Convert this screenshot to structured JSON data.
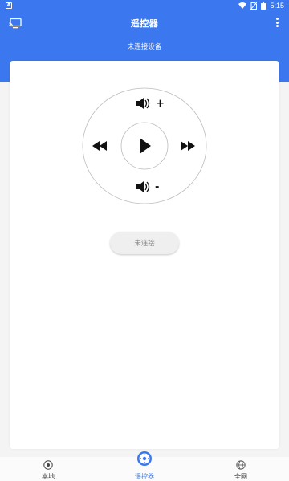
{
  "status_bar": {
    "notification_icon": "A",
    "time": "5:15",
    "icons": [
      "wifi-icon",
      "no-sim-icon",
      "battery-icon"
    ]
  },
  "app_bar": {
    "title": "遥控器",
    "subtitle": "未连接设备"
  },
  "remote": {
    "volume_up_label": "+",
    "volume_down_label": "-",
    "icons": [
      "volume-up-icon",
      "volume-down-icon",
      "rewind-icon",
      "fast-forward-icon",
      "play-icon"
    ]
  },
  "connect_button": {
    "label": "未连接"
  },
  "bottom_nav": {
    "items": [
      {
        "label": "本地",
        "icon": "disc-icon",
        "active": false
      },
      {
        "label": "遥控器",
        "icon": "remote-dpad-icon",
        "active": true
      },
      {
        "label": "全网",
        "icon": "globe-icon",
        "active": false
      }
    ]
  },
  "colors": {
    "primary": "#3b78ef",
    "background": "#f4f4f4",
    "card": "#ffffff",
    "button_bg": "#efefef",
    "disabled_text": "#8a8a8a"
  }
}
